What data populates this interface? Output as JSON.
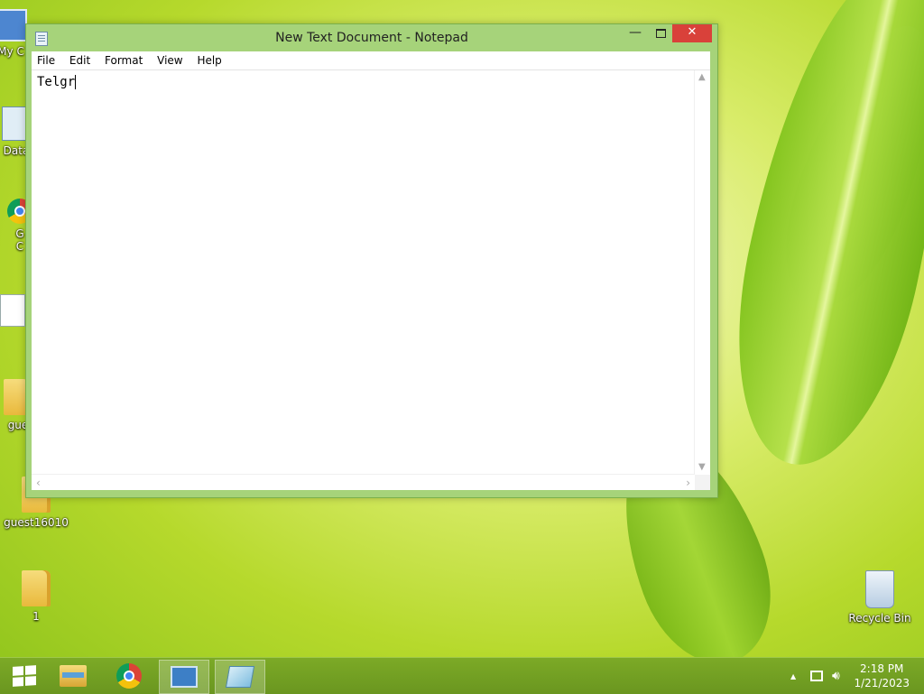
{
  "window": {
    "title": "New Text Document - Notepad",
    "minimize": "—",
    "close": "✕"
  },
  "menu": [
    "File",
    "Edit",
    "Format",
    "View",
    "Help"
  ],
  "editor": {
    "text": "Telgr"
  },
  "desktop": {
    "icons": [
      {
        "label": "guest16010"
      },
      {
        "label": "1"
      },
      {
        "label": "Recycle Bin"
      }
    ],
    "partial_labels": [
      "My C",
      "Data",
      "G",
      "C",
      "gue"
    ]
  },
  "taskbar": {
    "time": "2:18 PM",
    "date": "1/21/2023",
    "tray_chevron": "▲",
    "icons": [
      "windows-start-icon",
      "file-explorer-icon",
      "chrome-icon",
      "remote-desktop-icon",
      "notepad-icon"
    ]
  }
}
